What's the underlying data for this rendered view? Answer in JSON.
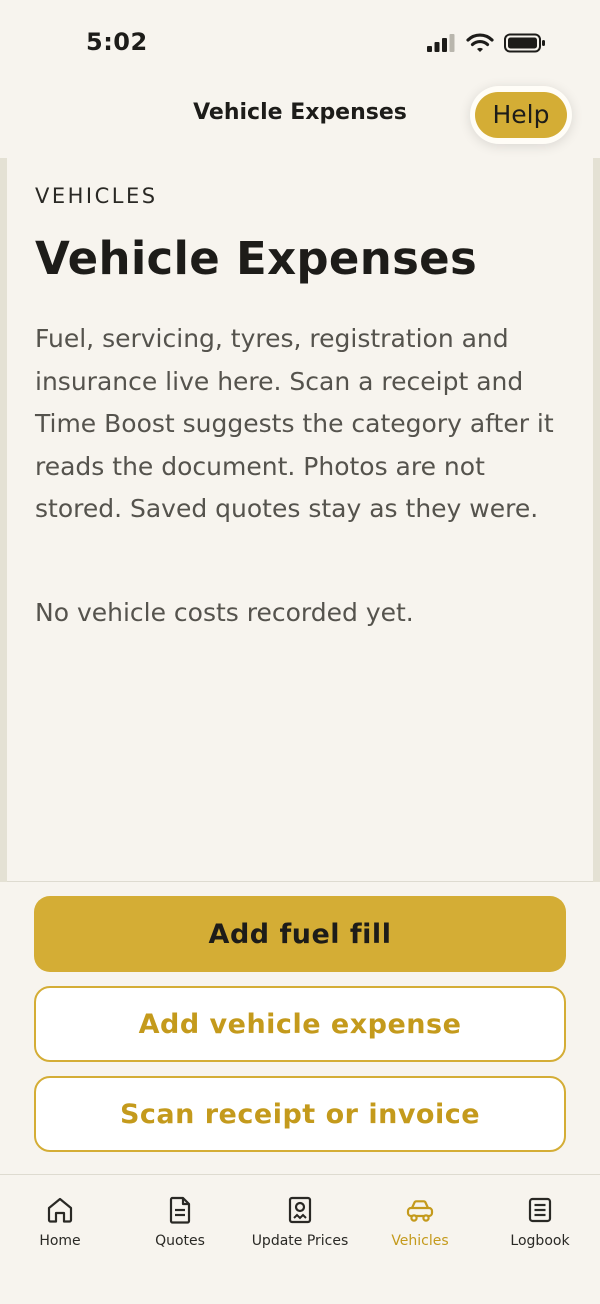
{
  "status_bar": {
    "time": "5:02"
  },
  "header": {
    "title": "Vehicle Expenses",
    "help_label": "Help"
  },
  "content": {
    "eyebrow": "VEHICLES",
    "title": "Vehicle Expenses",
    "description": "Fuel, servicing, tyres, registration and insurance live here. Scan a receipt and Time Boost suggests the category after it reads the document. Photos are not stored. Saved quotes stay as they were.",
    "empty_state": "No vehicle costs recorded yet."
  },
  "actions": {
    "add_fuel": "Add fuel fill",
    "add_expense": "Add vehicle expense",
    "scan_receipt": "Scan receipt or invoice"
  },
  "tabs": [
    {
      "label": "Home",
      "icon": "home-icon",
      "active": false
    },
    {
      "label": "Quotes",
      "icon": "document-icon",
      "active": false
    },
    {
      "label": "Update Prices",
      "icon": "receipt-icon",
      "active": false
    },
    {
      "label": "Vehicles",
      "icon": "car-icon",
      "active": true
    },
    {
      "label": "Logbook",
      "icon": "logbook-icon",
      "active": false
    }
  ],
  "colors": {
    "accent": "#d4ad35",
    "accent_text": "#c49a1c",
    "background": "#f7f4ee",
    "text": "#1d1c19",
    "muted_text": "#55534d"
  }
}
